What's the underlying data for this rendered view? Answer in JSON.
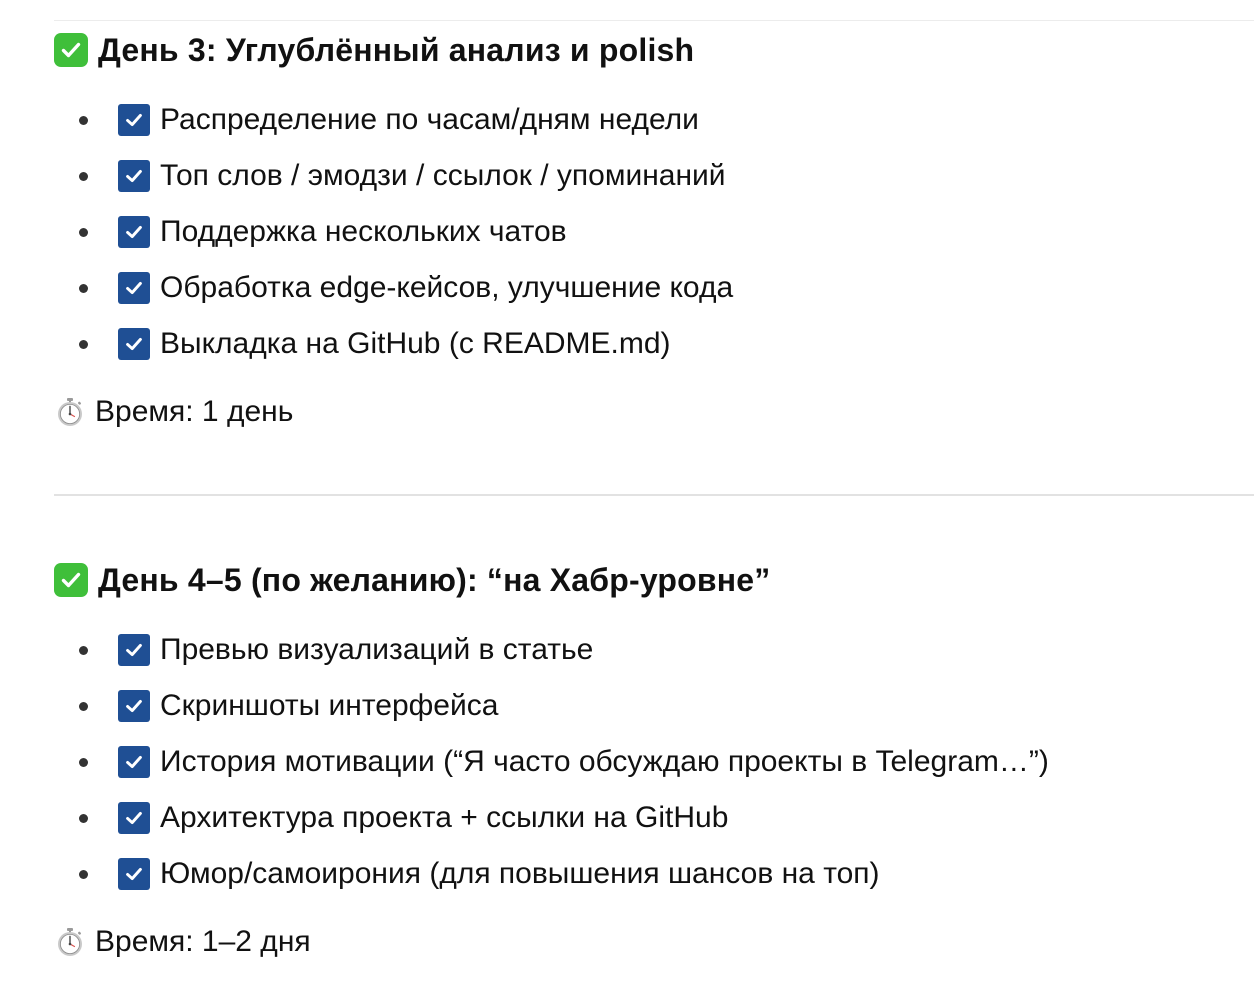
{
  "sections": [
    {
      "title": "День 3: Углублённый анализ и polish",
      "items": [
        "Распределение по часам/дням недели",
        "Топ слов / эмодзи / ссылок / упоминаний",
        "Поддержка нескольких чатов",
        "Обработка edge-кейсов, улучшение кода",
        "Выкладка на GitHub (с README.md)"
      ],
      "time": "Время: 1 день"
    },
    {
      "title": "День 4–5 (по желанию): “на Хабр-уровне”",
      "items": [
        "Превью визуализаций в статье",
        "Скриншоты интерфейса",
        "История мотивации (“Я часто обсуждаю проекты в Telegram…”)",
        "Архитектура проекта + ссылки на GitHub",
        "Юмор/самоирония (для повышения шансов на топ)"
      ],
      "time": "Время: 1–2 дня"
    }
  ],
  "icons": {
    "heading": "green-check-mark-icon",
    "item": "blue-checkbox-icon",
    "time": "stopwatch-icon"
  },
  "colors": {
    "heading_check": "#3fbf3a",
    "item_checkbox": "#1f4f94",
    "text": "#111111"
  }
}
